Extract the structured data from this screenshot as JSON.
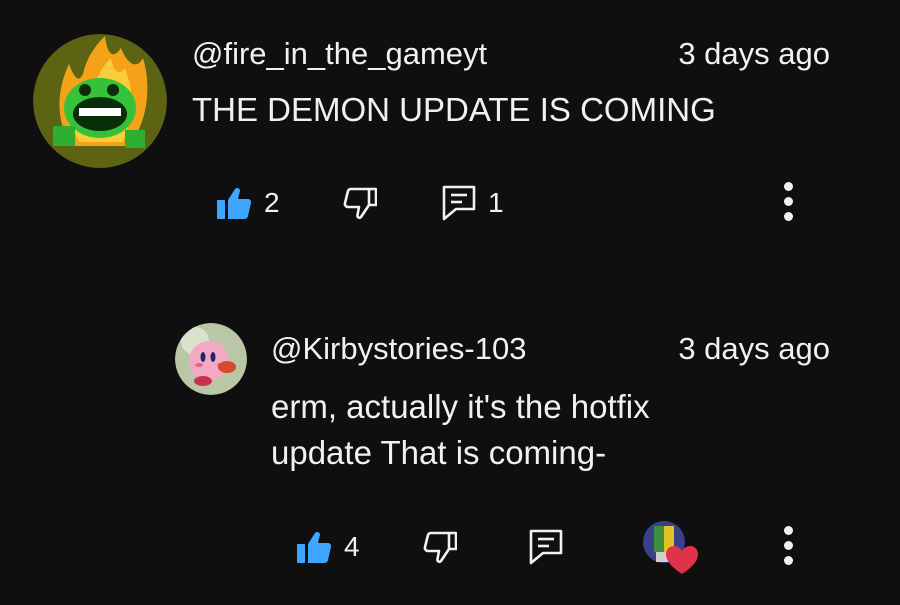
{
  "comments": [
    {
      "handle": "@fire_in_the_gameyt",
      "time": "3 days ago",
      "text": "THE DEMON UPDATE IS COMING",
      "likes": "2",
      "replies": "1",
      "liked": true
    },
    {
      "handle": "@Kirbystories-103",
      "time": "3 days ago",
      "text": "erm, actually it's the hotfix\nupdate That is coming-",
      "likes": "4",
      "liked": true,
      "creator_heart": true
    }
  ],
  "icons": {
    "like": "thumbs-up-icon",
    "dislike": "thumbs-down-icon",
    "reply": "reply-icon",
    "more": "more-vertical-icon",
    "heart": "heart-icon"
  },
  "colors": {
    "background": "#0f0f0f",
    "text": "#f1f1f1",
    "liked": "#3ea6ff",
    "heart": "#e0334a"
  }
}
